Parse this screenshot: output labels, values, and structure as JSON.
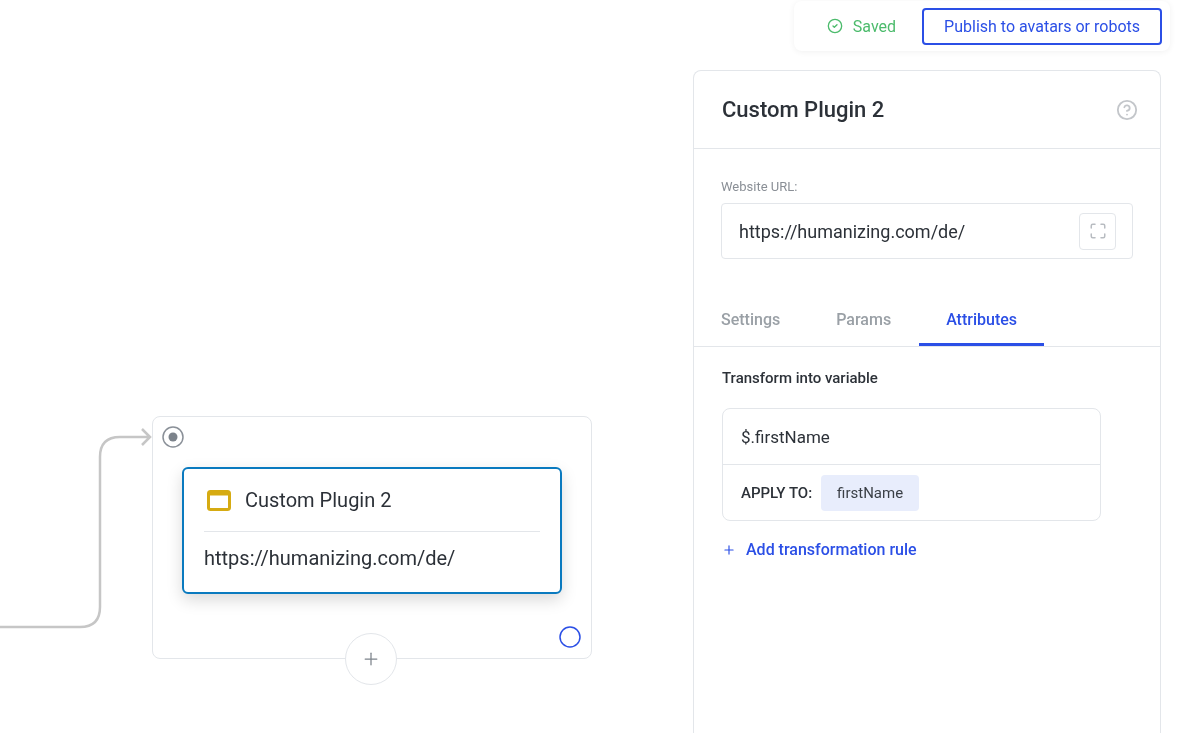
{
  "topbar": {
    "status": "Saved",
    "publish_button": "Publish to avatars or robots"
  },
  "canvas": {
    "node": {
      "title": "Custom Plugin 2",
      "url": "https://humanizing.com/de/",
      "selected": true
    }
  },
  "panel": {
    "title": "Custom Plugin 2",
    "url_label": "Website URL:",
    "url_value": "https://humanizing.com/de/",
    "tabs": [
      {
        "label": "Settings",
        "selected": false
      },
      {
        "label": "Params",
        "selected": false
      },
      {
        "label": "Attributes",
        "selected": true
      }
    ],
    "section_title": "Transform into variable",
    "rules": [
      {
        "expression": "$.firstName",
        "apply_label": "APPLY TO:",
        "apply_value": "firstName"
      }
    ],
    "add_rule": "Add transformation rule"
  }
}
